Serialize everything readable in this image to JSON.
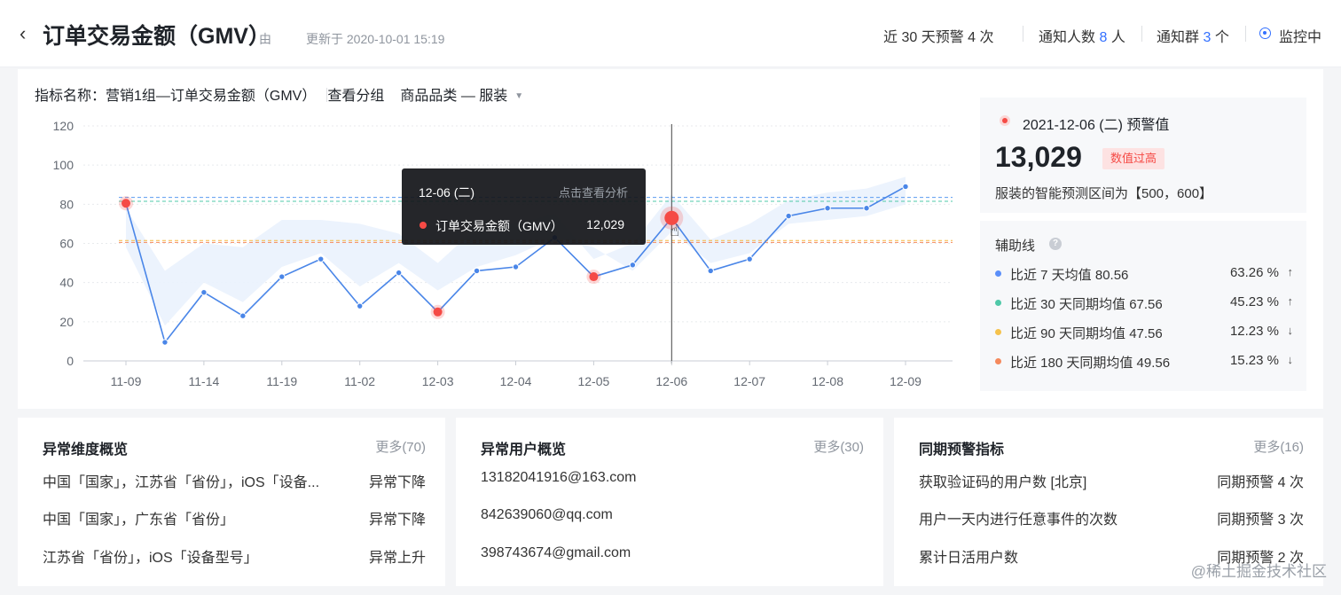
{
  "header": {
    "back_icon": "chevron-left-icon",
    "title": "订单交易金额（GMV）",
    "by_label": "由",
    "updated": "更新于 2020-10-01 15:19",
    "alerts_label": "近 30 天预警 4 次",
    "notify_people_prefix": "通知人数",
    "notify_people_count": "8",
    "notify_people_suffix": "人",
    "notify_groups_prefix": "通知群",
    "notify_groups_count": "3",
    "notify_groups_suffix": "个",
    "status_label": "监控中"
  },
  "filters": {
    "metric": "指标名称：营销1组—订单交易金额（GMV）",
    "group": "查看分组",
    "category": "商品品类 — 服装"
  },
  "chart_data": {
    "type": "line",
    "x": [
      "11-09",
      "",
      "11-14",
      "",
      "11-19",
      "",
      "11-02",
      "",
      "12-03",
      "",
      "12-04",
      "",
      "12-05",
      "",
      "12-06",
      "",
      "12-07",
      "",
      "12-08",
      "",
      "12-09"
    ],
    "x_ticks": [
      "11-09",
      "11-14",
      "11-19",
      "11-02",
      "12-03",
      "12-04",
      "12-05",
      "12-06",
      "12-07",
      "12-08",
      "12-09"
    ],
    "series": [
      {
        "values": [
          80.5,
          9.5,
          35,
          23,
          43,
          52,
          28,
          45,
          25,
          46,
          48,
          63,
          43,
          49,
          73,
          46,
          52,
          74,
          78,
          78,
          89
        ]
      }
    ],
    "anomaly_points": [
      0,
      8,
      12,
      14
    ],
    "band": {
      "upper": [
        78,
        46,
        60,
        58,
        72,
        72,
        70,
        65,
        50,
        68,
        70,
        75,
        52,
        60,
        85,
        62,
        70,
        82,
        86,
        88,
        94
      ],
      "lower": [
        58,
        18,
        40,
        30,
        48,
        55,
        38,
        50,
        36,
        48,
        54,
        63,
        58,
        46,
        66,
        50,
        55,
        70,
        72,
        74,
        80
      ]
    },
    "reference_lines": [
      {
        "value": 83.5,
        "color": "#5b9bf0"
      },
      {
        "value": 81.5,
        "color": "#4fc8a8"
      },
      {
        "value": 61.5,
        "color": "#f5b942"
      },
      {
        "value": 60.5,
        "color": "#f5895c"
      }
    ],
    "ylim": [
      0,
      120
    ],
    "y_ticks": [
      "0",
      "20",
      "40",
      "60",
      "80",
      "100",
      "120"
    ],
    "crosshair_index": 14,
    "line_color": "#4a86e8",
    "anomaly_color": "#f54a45"
  },
  "tooltip": {
    "date": "12-06 (二)",
    "link": "点击查看分析",
    "series_name": "订单交易金额（GMV）",
    "value": "12,029"
  },
  "alert_panel": {
    "date": "2021-12-06 (二) 预警值",
    "value": "13,029",
    "badge": "数值过高",
    "range": "服装的智能预测区间为【500，600】"
  },
  "aux_lines": {
    "title": "辅助线",
    "help_icon": "question-icon",
    "items": [
      {
        "label": "比近 7 天均值 80.56",
        "pct": "63.26 %",
        "arrow": "↑",
        "color": "#5b8ff9"
      },
      {
        "label": "比近 30 天同期均值 67.56",
        "pct": "45.23 %",
        "arrow": "↑",
        "color": "#4fc8a8"
      },
      {
        "label": "比近 90 天同期均值 47.56",
        "pct": "12.23 %",
        "arrow": "↓",
        "color": "#f5c24c"
      },
      {
        "label": "比近 180 天同期均值 49.56",
        "pct": "15.23 %",
        "arrow": "↓",
        "color": "#f5895c"
      }
    ]
  },
  "dimension_card": {
    "title": "异常维度概览",
    "more": "更多(70)",
    "rows": [
      {
        "left": "中国「国家」，江苏省「省份」，iOS「设备...",
        "right": "异常下降"
      },
      {
        "left": "中国「国家」，广东省「省份」",
        "right": "异常下降"
      },
      {
        "left": "江苏省「省份」，iOS「设备型号」",
        "right": "异常上升"
      }
    ]
  },
  "user_card": {
    "title": "异常用户概览",
    "more": "更多(30)",
    "rows": [
      {
        "left": "13182041916@163.com"
      },
      {
        "left": "842639060@qq.com"
      },
      {
        "left": "398743674@gmail.com"
      }
    ]
  },
  "peer_card": {
    "title": "同期预警指标",
    "more": "更多(16)",
    "rows": [
      {
        "left": "获取验证码的用户数 [北京]",
        "right": "同期预警 4 次"
      },
      {
        "left": "用户一天内进行任意事件的次数",
        "right": "同期预警 3 次"
      },
      {
        "left": "累计日活用户数",
        "right": "同期预警 2 次"
      }
    ]
  },
  "watermark": "@稀土掘金技术社区"
}
